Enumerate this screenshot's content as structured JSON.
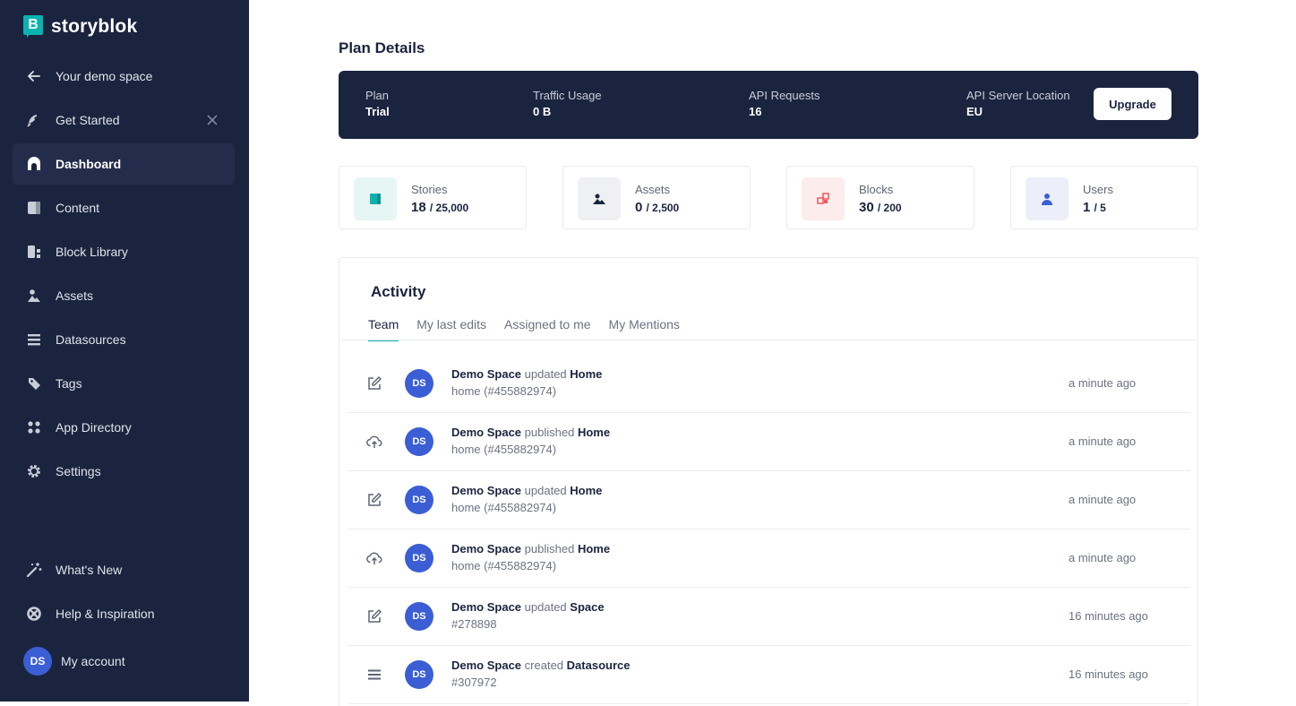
{
  "brand": {
    "logo_letter": "B",
    "name": "storyblok",
    "accent": "#09b3af"
  },
  "sidebar": {
    "back_label": "Your demo space",
    "items": [
      {
        "label": "Get Started",
        "icon": "rocket-icon"
      },
      {
        "label": "Dashboard",
        "icon": "dashboard-icon",
        "active": true
      },
      {
        "label": "Content",
        "icon": "content-icon"
      },
      {
        "label": "Block Library",
        "icon": "block-library-icon"
      },
      {
        "label": "Assets",
        "icon": "assets-icon"
      },
      {
        "label": "Datasources",
        "icon": "datasources-icon"
      },
      {
        "label": "Tags",
        "icon": "tag-icon"
      },
      {
        "label": "App Directory",
        "icon": "app-directory-icon"
      },
      {
        "label": "Settings",
        "icon": "gear-icon"
      }
    ],
    "bottom": [
      {
        "label": "What's New",
        "icon": "magic-wand-icon"
      },
      {
        "label": "Help & Inspiration",
        "icon": "lifebuoy-icon"
      }
    ],
    "account": {
      "initials": "DS",
      "label": "My account"
    }
  },
  "main": {
    "title": "Plan Details",
    "plan": {
      "plan_label": "Plan",
      "plan_value": "Trial",
      "traffic_label": "Traffic Usage",
      "traffic_value": "0 B",
      "api_label": "API Requests",
      "api_value": "16",
      "location_label": "API Server Location",
      "location_value": "EU",
      "upgrade_label": "Upgrade"
    },
    "stats": [
      {
        "label": "Stories",
        "value": "18",
        "limit": "/ 25,000",
        "icon": "stories-icon",
        "color": "#09b3af"
      },
      {
        "label": "Assets",
        "value": "0",
        "limit": "/ 2,500",
        "icon": "assets-icon",
        "color": "#1b243f"
      },
      {
        "label": "Blocks",
        "value": "30",
        "limit": "/ 200",
        "icon": "blocks-icon",
        "color": "#f2555a"
      },
      {
        "label": "Users",
        "value": "1",
        "limit": "/ 5",
        "icon": "user-icon",
        "color": "#3b5ed4"
      }
    ],
    "activity": {
      "title": "Activity",
      "tabs": [
        "Team",
        "My last edits",
        "Assigned to me",
        "My Mentions"
      ],
      "active_tab": 0,
      "rows": [
        {
          "icon": "edit-icon",
          "initials": "DS",
          "actor": "Demo Space",
          "verb": "updated",
          "object": "Home",
          "detail": "home (#455882974)",
          "time": "a minute ago"
        },
        {
          "icon": "upload-icon",
          "initials": "DS",
          "actor": "Demo Space",
          "verb": "published",
          "object": "Home",
          "detail": "home (#455882974)",
          "time": "a minute ago"
        },
        {
          "icon": "edit-icon",
          "initials": "DS",
          "actor": "Demo Space",
          "verb": "updated",
          "object": "Home",
          "detail": "home (#455882974)",
          "time": "a minute ago"
        },
        {
          "icon": "upload-icon",
          "initials": "DS",
          "actor": "Demo Space",
          "verb": "published",
          "object": "Home",
          "detail": "home (#455882974)",
          "time": "a minute ago"
        },
        {
          "icon": "edit-icon",
          "initials": "DS",
          "actor": "Demo Space",
          "verb": "updated",
          "object": "Space",
          "detail": "#278898",
          "time": "16 minutes ago"
        },
        {
          "icon": "datasources-icon",
          "initials": "DS",
          "actor": "Demo Space",
          "verb": "created",
          "object": "Datasource",
          "detail": "#307972",
          "time": "16 minutes ago"
        }
      ]
    }
  }
}
